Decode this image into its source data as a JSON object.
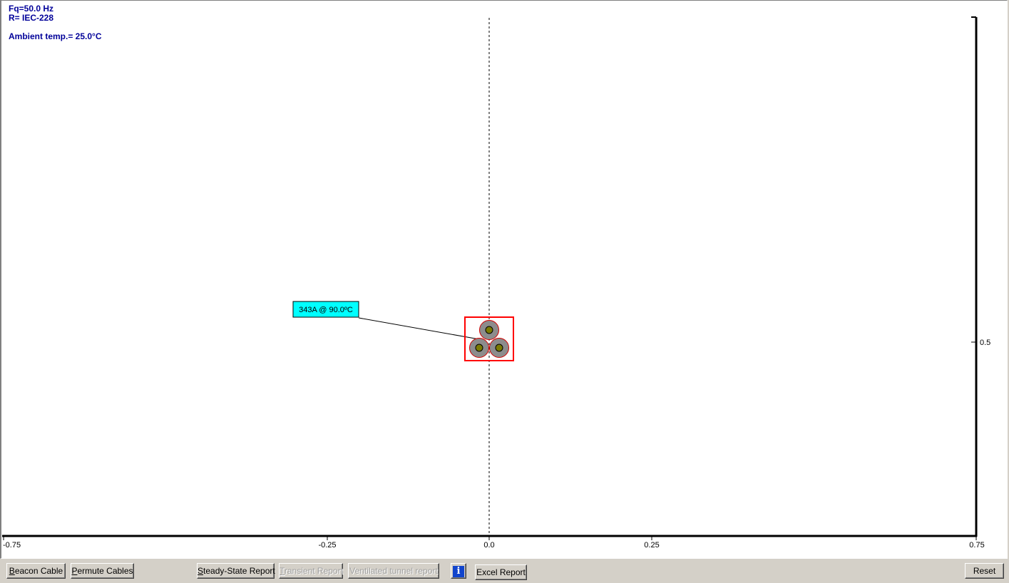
{
  "header": {
    "frequency": "Fq=50.0 Hz",
    "method": "R= IEC-228",
    "ambient": "Ambient temp.= 25.0°C"
  },
  "plot": {
    "x_ticks": [
      "-0.75",
      "-0.25",
      "0.0",
      "0.25",
      "0.75"
    ],
    "y_ticks": [
      "0.5"
    ],
    "cable_label": "343A @ 90.0ºC",
    "colors": {
      "label_bg": "#00ffff",
      "bounding_box": "#ff0000",
      "sheath": "#8c8c8c",
      "core": "#7a7a00",
      "text_blue": "#000099"
    }
  },
  "toolbar": {
    "beacon_cable": "Beacon Cable",
    "permute_cables": "Permute Cables",
    "steady_state_report": "Steady-State Report",
    "transient_report": "Transient Report",
    "ventilated_tunnel_report": "Ventilated tunnel report",
    "info_icon": "info-icon",
    "info_glyph": "i",
    "excel_report": "Excel Report",
    "reset": "Reset"
  }
}
